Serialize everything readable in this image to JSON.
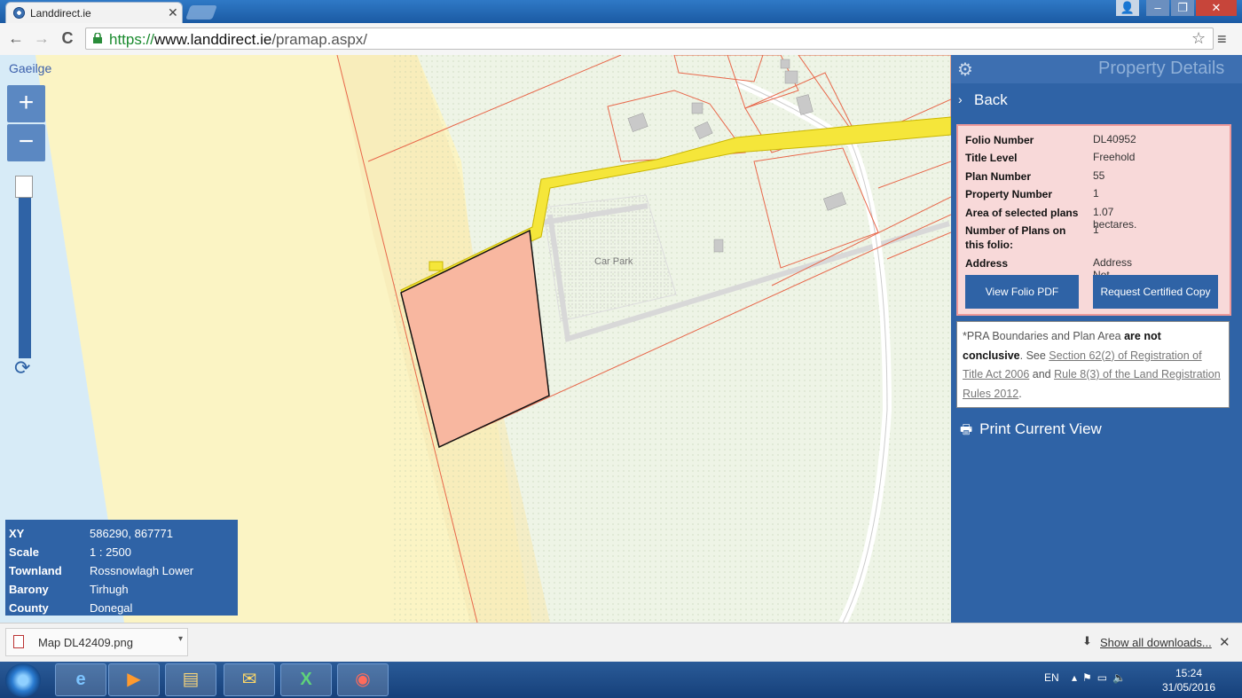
{
  "browser": {
    "tab_title": "Landdirect.ie",
    "tab_close": "✕",
    "url_scheme": "https://",
    "url_host": "www.landdirect.ie",
    "url_path": "/pramap.aspx/",
    "back_icon": "←",
    "forward_icon": "→",
    "reload_icon": "C",
    "star_icon": "☆",
    "menu_icon": "≡",
    "window": {
      "min": "–",
      "max": "❐",
      "close": "✕"
    }
  },
  "map": {
    "language_link": "Gaeilge",
    "zoom_in": "+",
    "zoom_out": "−",
    "refresh_icon": "⟳",
    "car_park_label": "Car Park",
    "info": [
      {
        "key": "XY",
        "value": "586290, 867771"
      },
      {
        "key": "Scale",
        "value": "1 : 2500"
      },
      {
        "key": "Townland",
        "value": "Rossnowlagh Lower"
      },
      {
        "key": "Barony",
        "value": "Tirhugh"
      },
      {
        "key": "County",
        "value": "Donegal"
      }
    ],
    "colors": {
      "sand": "#fbf4c4",
      "grass": "#eef4e6",
      "parcel": "#f8b7a0",
      "road": "#f5e63a",
      "boundary": "#e8674a"
    }
  },
  "panel": {
    "title": "Property Details",
    "back_label": "Back",
    "details": [
      {
        "key": "Folio Number",
        "value": "DL40952"
      },
      {
        "key": "Title Level",
        "value": "Freehold"
      },
      {
        "key": "Plan Number",
        "value": "55"
      },
      {
        "key": "Property Number",
        "value": "1"
      },
      {
        "key": "Area of selected plans",
        "value": "1.07 hectares."
      },
      {
        "key": "Number of Plans on this folio:",
        "value": "1"
      },
      {
        "key": "Address",
        "value": "Address Not Available"
      }
    ],
    "btn_view_folio": "View Folio PDF",
    "btn_request_copy": "Request Certified Copy",
    "note": {
      "prefix": "*PRA Boundaries and Plan Area ",
      "bold": "are not conclusive",
      "middle": ". See ",
      "link1": "Section 62(2) of Registration of Title Act 2006",
      "and": " and ",
      "link2": "Rule 8(3) of the Land Registration Rules 2012",
      "suffix": "."
    },
    "print_label": "Print Current View",
    "accent": "#2f63a6"
  },
  "downloads": {
    "file_name": "Map DL42409.png",
    "show_all": "Show all downloads...",
    "close": "✕",
    "dropdown": "▾"
  },
  "taskbar": {
    "language": "EN",
    "time": "15:24",
    "date": "31/05/2016"
  }
}
